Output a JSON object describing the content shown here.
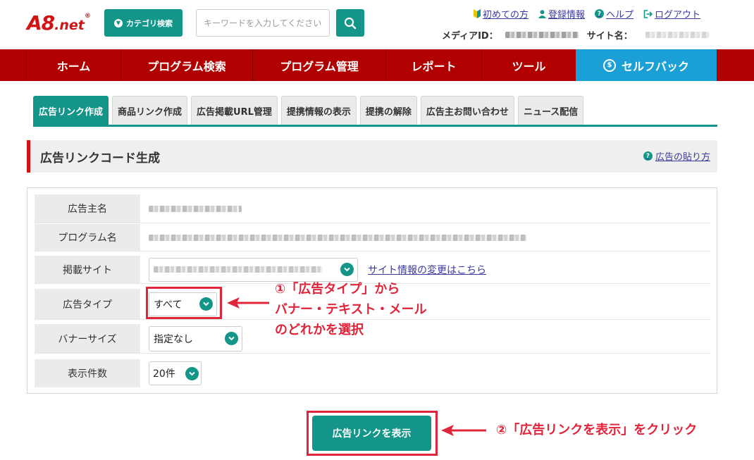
{
  "header": {
    "logo_main": "A8",
    "logo_suffix": ".net",
    "logo_reg": "®",
    "category_button": "カテゴリ検索",
    "search_placeholder": "キーワードを入力してください",
    "links": {
      "beginner": "初めての方",
      "register": "登録情報",
      "help": "ヘルプ",
      "logout": "ログアウト"
    },
    "media_id_label": "メディアID：",
    "site_name_label": "サイト名："
  },
  "nav": {
    "items": [
      "ホーム",
      "プログラム検索",
      "プログラム管理",
      "レポート",
      "ツール"
    ],
    "selfback": "セルフバック"
  },
  "tabs": [
    "広告リンク作成",
    "商品リンク作成",
    "広告掲載URL管理",
    "提携情報の表示",
    "提携の解除",
    "広告主お問い合わせ",
    "ニュース配信"
  ],
  "section": {
    "title": "広告リンクコード生成",
    "help_link": "広告の貼り方"
  },
  "form": {
    "advertiser_label": "広告主名",
    "program_label": "プログラム名",
    "site_label": "掲載サイト",
    "site_change_link": "サイト情報の変更はこちら",
    "ad_type_label": "広告タイプ",
    "ad_type_value": "すべて",
    "banner_size_label": "バナーサイズ",
    "banner_size_value": "指定なし",
    "count_label": "表示件数",
    "count_value": "20件"
  },
  "annotations": {
    "step1_line1": "①「広告タイプ」から",
    "step1_line2": "バナー・テキスト・メール",
    "step1_line3": "のどれかを選択",
    "step2": "②「広告リンクを表示」をクリック"
  },
  "submit_button": "広告リンクを表示",
  "colors": {
    "brand_red": "#b00000",
    "accent_teal": "#14958a",
    "selfback_blue": "#1a9fd6",
    "annotation_red": "#e0243a"
  }
}
